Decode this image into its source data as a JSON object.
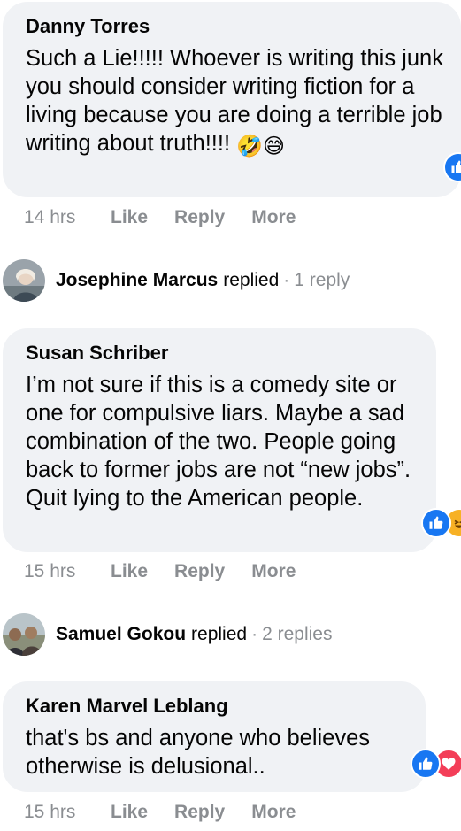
{
  "comments": [
    {
      "author": "Danny Torres",
      "text": "Such a Lie!!!!! Whoever is writing this junk you should consider writing fiction for a living because you are doing a terrible job writing about truth!!!! ",
      "emoji_1": "🤣",
      "emoji_2": "😅",
      "time": "14 hrs",
      "like_label": "Like",
      "reply_label": "Reply",
      "more_label": "More",
      "reactions": [
        "like"
      ]
    },
    {
      "author": "Susan Schriber",
      "text": "I’m not sure if this is a comedy site or one for compulsive liars. Maybe a sad combination of the two. People going back to former jobs are not “new jobs”. Quit lying to the American people.",
      "time": "15 hrs",
      "like_label": "Like",
      "reply_label": "Reply",
      "more_label": "More",
      "reactions": [
        "like",
        "haha"
      ]
    },
    {
      "author": "Karen Marvel Leblang",
      "text": "that's bs and anyone who believes otherwise is delusional..",
      "time": "15 hrs",
      "like_label": "Like",
      "reply_label": "Reply",
      "more_label": "More",
      "reactions": [
        "like",
        "love"
      ]
    }
  ],
  "replies": [
    {
      "name": "Josephine Marcus",
      "verb": "replied",
      "separator": "·",
      "count": "1 reply"
    },
    {
      "name": "Samuel Gokou",
      "verb": "replied",
      "separator": "·",
      "count": "2 replies"
    }
  ],
  "colors": {
    "bubble_bg": "#f0f2f5",
    "secondary_text": "#65676b",
    "like_blue": "#1877f2",
    "love_red": "#f33e58",
    "haha_yellow": "#f7b125"
  }
}
